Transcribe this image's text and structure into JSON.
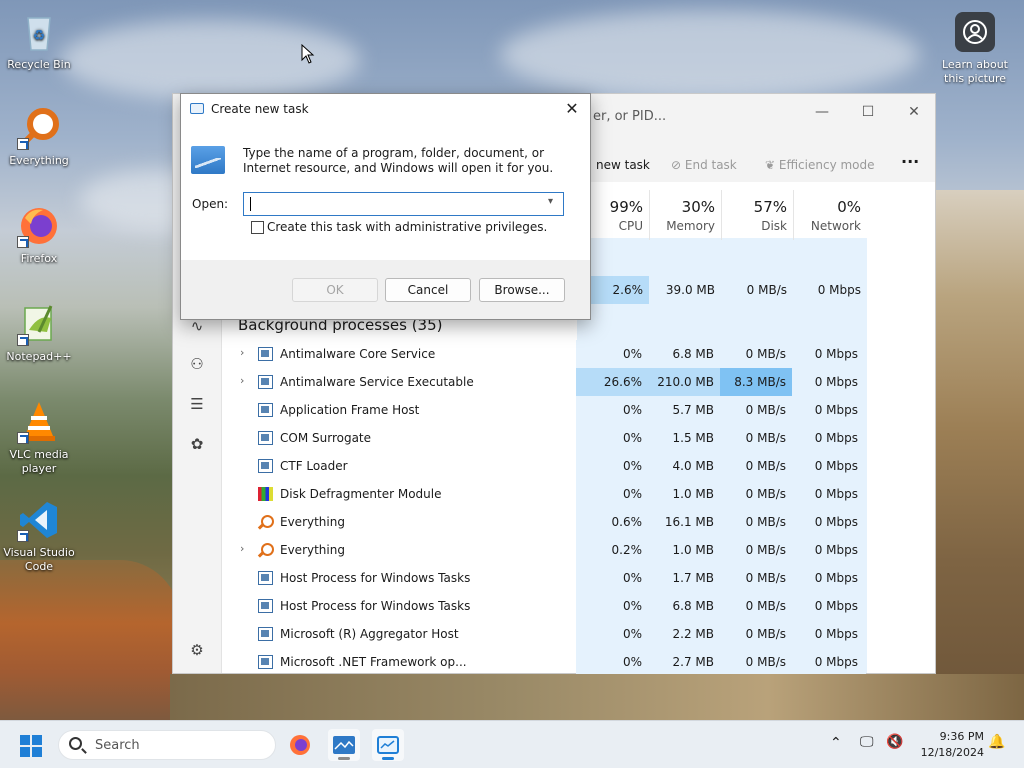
{
  "desktop": {
    "icons": [
      {
        "label": "Recycle Bin"
      },
      {
        "label": "Everything"
      },
      {
        "label": "Firefox"
      },
      {
        "label": "Notepad++"
      },
      {
        "label": "VLC media player"
      },
      {
        "label": "Visual Studio Code"
      }
    ],
    "learn_label": "Learn about this picture"
  },
  "task_manager": {
    "search_placeholder": "er, or PID...",
    "toolbar": {
      "run_new_task": "new task",
      "end_task": "End task",
      "efficiency_mode": "Efficiency mode",
      "more": "···"
    },
    "columns": [
      {
        "pct": "99%",
        "label": "CPU"
      },
      {
        "pct": "30%",
        "label": "Memory"
      },
      {
        "pct": "57%",
        "label": "Disk"
      },
      {
        "pct": "0%",
        "label": "Network"
      }
    ],
    "app_row": {
      "cpu": "2.6%",
      "mem": "39.0 MB",
      "disk": "0 MB/s",
      "net": "0 Mbps"
    },
    "section_title": "Background processes (35)",
    "processes": [
      {
        "name": "Antimalware Core Service",
        "expand": true,
        "icon": "win",
        "cpu": "0%",
        "mem": "6.8 MB",
        "disk": "0 MB/s",
        "net": "0 Mbps"
      },
      {
        "name": "Antimalware Service Executable",
        "expand": true,
        "icon": "win",
        "cpu": "26.6%",
        "mem": "210.0 MB",
        "disk": "8.3 MB/s",
        "net": "0 Mbps"
      },
      {
        "name": "Application Frame Host",
        "expand": false,
        "icon": "win",
        "cpu": "0%",
        "mem": "5.7 MB",
        "disk": "0 MB/s",
        "net": "0 Mbps"
      },
      {
        "name": "COM Surrogate",
        "expand": false,
        "icon": "win",
        "cpu": "0%",
        "mem": "1.5 MB",
        "disk": "0 MB/s",
        "net": "0 Mbps"
      },
      {
        "name": "CTF Loader",
        "expand": false,
        "icon": "win",
        "cpu": "0%",
        "mem": "4.0 MB",
        "disk": "0 MB/s",
        "net": "0 Mbps"
      },
      {
        "name": "Disk Defragmenter Module",
        "expand": false,
        "icon": "defrag",
        "cpu": "0%",
        "mem": "1.0 MB",
        "disk": "0 MB/s",
        "net": "0 Mbps"
      },
      {
        "name": "Everything",
        "expand": false,
        "icon": "evr",
        "cpu": "0.6%",
        "mem": "16.1 MB",
        "disk": "0 MB/s",
        "net": "0 Mbps"
      },
      {
        "name": "Everything",
        "expand": true,
        "icon": "evr",
        "cpu": "0.2%",
        "mem": "1.0 MB",
        "disk": "0 MB/s",
        "net": "0 Mbps"
      },
      {
        "name": "Host Process for Windows Tasks",
        "expand": false,
        "icon": "win",
        "cpu": "0%",
        "mem": "1.7 MB",
        "disk": "0 MB/s",
        "net": "0 Mbps"
      },
      {
        "name": "Host Process for Windows Tasks",
        "expand": false,
        "icon": "win",
        "cpu": "0%",
        "mem": "6.8 MB",
        "disk": "0 MB/s",
        "net": "0 Mbps"
      },
      {
        "name": "Microsoft (R) Aggregator Host",
        "expand": false,
        "icon": "win",
        "cpu": "0%",
        "mem": "2.2 MB",
        "disk": "0 MB/s",
        "net": "0 Mbps"
      },
      {
        "name": "Microsoft .NET Framework op...",
        "expand": false,
        "icon": "win",
        "cpu": "0%",
        "mem": "2.7 MB",
        "disk": "0 MB/s",
        "net": "0 Mbps"
      }
    ]
  },
  "dialog": {
    "title": "Create new task",
    "description": "Type the name of a program, folder, document, or Internet resource, and Windows will open it for you.",
    "open_label": "Open:",
    "open_value": "",
    "admin_checkbox_label": "Create this task with administrative privileges.",
    "ok_label": "OK",
    "cancel_label": "Cancel",
    "browse_label": "Browse..."
  },
  "taskbar": {
    "search_label": "Search",
    "time": "9:36 PM",
    "date": "12/18/2024"
  },
  "colors": {
    "accent": "#1f7fd6",
    "cpu_col_bg": "#e5f2fd",
    "highlight_bg": "#b6dcf8",
    "disk_highlight": "#7fc2f3"
  }
}
